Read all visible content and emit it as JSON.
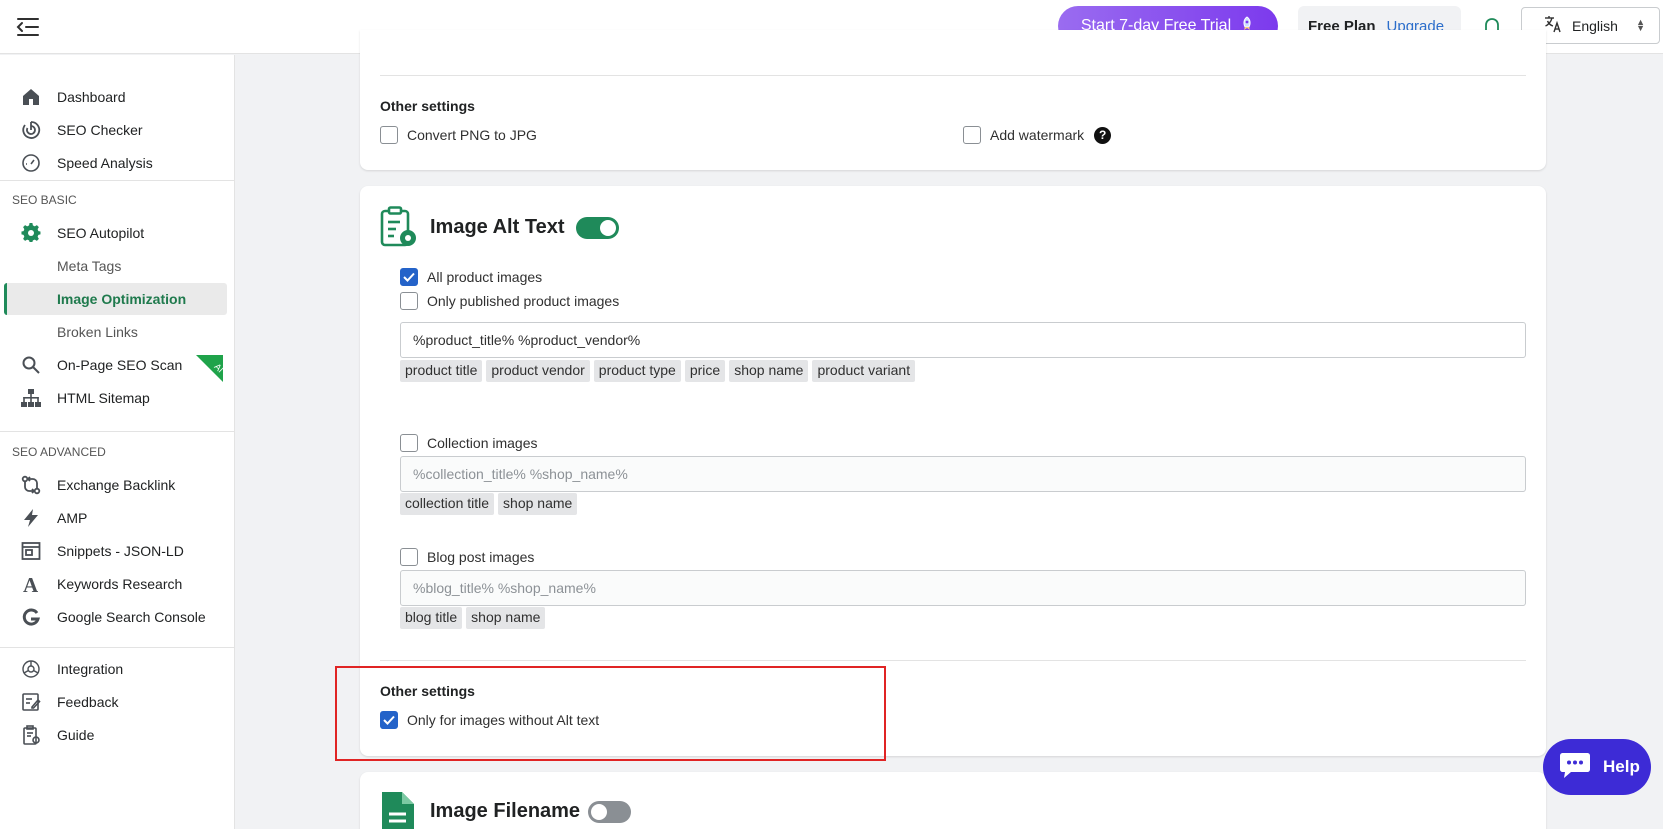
{
  "topbar": {
    "trial_label": "Start 7-day Free Trial",
    "plan_label": "Free Plan",
    "upgrade_label": "Upgrade",
    "language": "English"
  },
  "sidebar": {
    "main": [
      {
        "label": "Dashboard",
        "icon": "home-icon"
      },
      {
        "label": "SEO Checker",
        "icon": "target-icon"
      },
      {
        "label": "Speed Analysis",
        "icon": "speedometer-icon"
      }
    ],
    "section_basic": "SEO BASIC",
    "basic": [
      {
        "label": "SEO Autopilot",
        "icon": "gear-icon"
      },
      {
        "label": "Meta Tags"
      },
      {
        "label": "Image Optimization",
        "active": true
      },
      {
        "label": "Broken Links"
      },
      {
        "label": "On-Page SEO Scan",
        "icon": "search-icon",
        "badge": "AI"
      },
      {
        "label": "HTML Sitemap",
        "icon": "sitemap-icon"
      }
    ],
    "section_advanced": "SEO ADVANCED",
    "advanced": [
      {
        "label": "Exchange Backlink",
        "icon": "exchange-icon"
      },
      {
        "label": "AMP",
        "icon": "bolt-icon"
      },
      {
        "label": "Snippets - JSON-LD",
        "icon": "snippet-icon"
      },
      {
        "label": "Keywords Research",
        "icon": "letter-a-icon"
      },
      {
        "label": "Google Search Console",
        "icon": "google-icon"
      }
    ],
    "bottom": [
      {
        "label": "Integration",
        "icon": "integration-icon"
      },
      {
        "label": "Feedback",
        "icon": "feedback-icon"
      },
      {
        "label": "Guide",
        "icon": "guide-icon"
      }
    ]
  },
  "image_compression_card": {
    "other_settings_label": "Other settings",
    "convert_png_label": "Convert PNG to JPG",
    "convert_png_checked": false,
    "add_watermark_label": "Add watermark",
    "add_watermark_checked": false,
    "help_glyph": "?"
  },
  "alt_text_card": {
    "title": "Image Alt Text",
    "enabled": true,
    "all_product_label": "All product images",
    "all_product_checked": true,
    "published_only_label": "Only published product images",
    "published_only_checked": false,
    "product_template": "%product_title% %product_vendor%",
    "product_tags": [
      "product title",
      "product vendor",
      "product type",
      "price",
      "shop name",
      "product variant"
    ],
    "collection_label": "Collection images",
    "collection_checked": false,
    "collection_placeholder": "%collection_title% %shop_name%",
    "collection_tags": [
      "collection title",
      "shop name"
    ],
    "blog_label": "Blog post images",
    "blog_checked": false,
    "blog_placeholder": "%blog_title% %shop_name%",
    "blog_tags": [
      "blog title",
      "shop name"
    ],
    "other_settings_label": "Other settings",
    "without_alt_label": "Only for images without Alt text",
    "without_alt_checked": true
  },
  "filename_card": {
    "title": "Image Filename",
    "enabled": false
  },
  "help_button": {
    "label": "Help"
  },
  "colors": {
    "accent_green": "#1f8a5a",
    "checkbox_blue": "#2463c9",
    "trial_purple": "#8b5cf6",
    "help_blue": "#3d2bd6",
    "highlight_red": "#e02424"
  }
}
